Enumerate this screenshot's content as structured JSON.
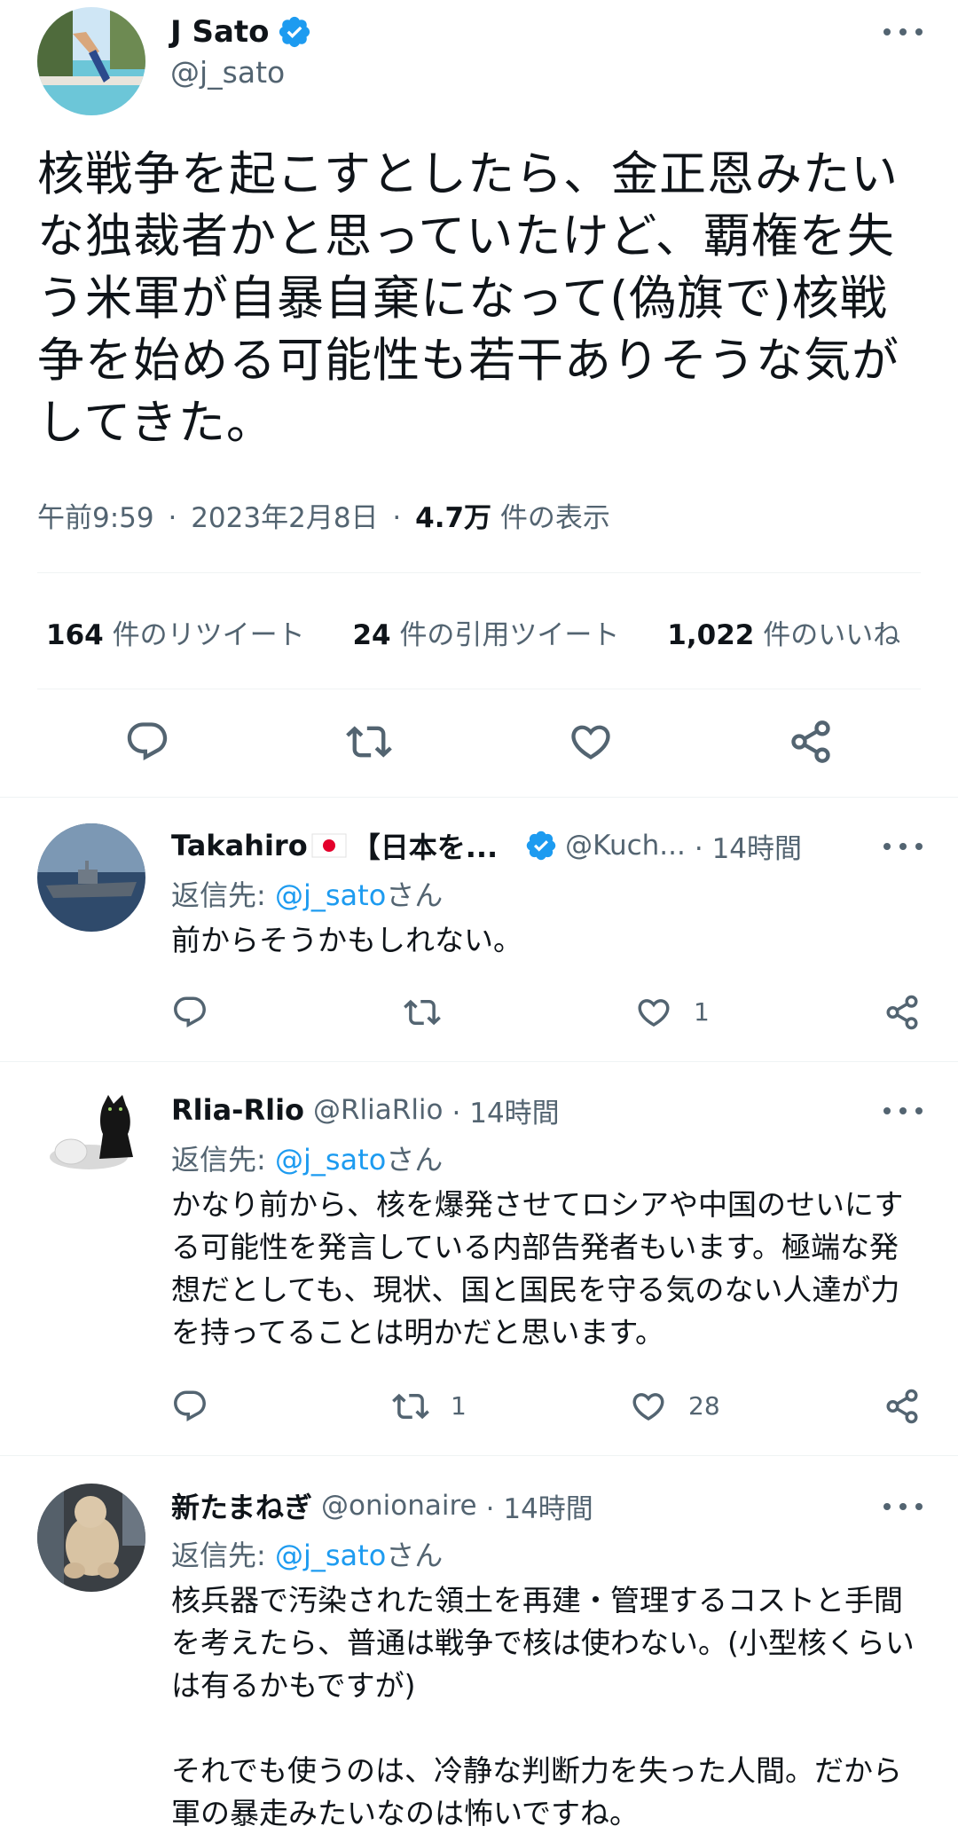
{
  "main_tweet": {
    "author_name": "J Sato",
    "handle": "@j_sato",
    "text": "核戦争を起こすとしたら、金正恩みたいな独裁者かと思っていたけど、覇権を失う米軍が自暴自棄になって(偽旗で)核戦争を始める可能性も若干ありそうな気がしてきた。",
    "time": "午前9:59",
    "date": "2023年2月8日",
    "views_count": "4.7万",
    "views_label": "件の表示",
    "sep": "·",
    "retweets_count": "164",
    "retweets_label": "件のリツイート",
    "quotes_count": "24",
    "quotes_label": "件の引用ツイート",
    "likes_count": "1,022",
    "likes_label": "件のいいね"
  },
  "replies": [
    {
      "name": "Takahiro",
      "name_suffix": "【日本を...",
      "handle": "@Kuch...",
      "time": "· 14時間",
      "reply_prefix": "返信先: ",
      "reply_to": "@j_sato",
      "reply_suffix": "さん",
      "text": "前からそうかもしれない。",
      "retweets": "",
      "likes": "1"
    },
    {
      "name": "Rlia-Rlio",
      "handle": "@RliaRlio",
      "time": "· 14時間",
      "reply_prefix": "返信先: ",
      "reply_to": "@j_sato",
      "reply_suffix": "さん",
      "text": "かなり前から、核を爆発させてロシアや中国のせいにする可能性を発言している内部告発者もいます。極端な発想だとしても、現状、国と国民を守る気のない人達が力を持ってることは明かだと思います。",
      "retweets": "1",
      "likes": "28"
    },
    {
      "name": "新たまねぎ",
      "handle": "@onionaire",
      "time": "· 14時間",
      "reply_prefix": "返信先: ",
      "reply_to": "@j_sato",
      "reply_suffix": "さん",
      "text": "核兵器で汚染された領土を再建・管理するコストと手間を考えたら、普通は戦争で核は使わない。(小型核くらいは有るかもですが)\n\nそれでも使うのは、冷静な判断力を失った人間。だから軍の暴走みたいなのは怖いですね。"
    }
  ],
  "colors": {
    "accent": "#1d9bf0",
    "text": "#0f1419",
    "muted": "#536471",
    "divider": "#eff3f4"
  }
}
